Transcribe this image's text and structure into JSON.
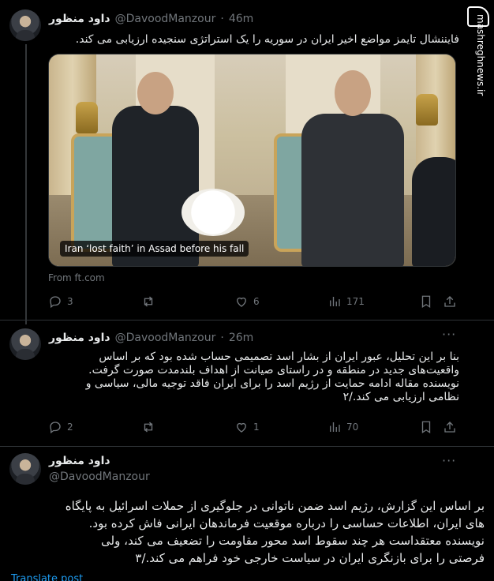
{
  "tweets": [
    {
      "name": "داود منظور",
      "handle": "@DavoodManzour",
      "time": "46m",
      "separator": "·",
      "text": "فایننشال تایمز مواضع اخیر ایران در سوریه را یک استراتژی سنجیده ارزیابی می کند.",
      "media_caption": "Iran ‘lost faith’ in Assad before his fall",
      "from": "From ft.com",
      "replies": "3",
      "likes": "6",
      "views": "171"
    },
    {
      "name": "داود منظور",
      "handle": "@DavoodManzour",
      "time": "26m",
      "separator": "·",
      "text_lines": [
        "بنا بر این تحلیل، عبور ایران از بشار اسد تصمیمی حساب شده بود که بر اساس",
        "واقعیت‌های جدید در منطقه و در راستای صیانت از اهداف بلندمدت صورت گرفت.",
        "نویسنده مقاله ادامه حمایت از رژیم اسد را برای ایران فاقد توجیه مالی، سیاسی و",
        "نظامی ارزیابی می کند./۲"
      ],
      "replies": "2",
      "likes": "1",
      "views": "70"
    },
    {
      "name": "داود منظور",
      "handle": "@DavoodManzour",
      "text_lines": [
        "بر اساس این گزارش، رژیم اسد ضمن ناتوانی در جلوگیری از حملات اسرائیل به پایگاه",
        "های ایران، اطلاعات حساسی را درباره موقعیت فرماندهان ایرانی فاش کرده بود.",
        "نویسنده معتقداست هر چند سقوط اسد محور مقاومت را تضعیف می کند، ولی",
        "فرصتی را برای بازنگری ایران در سیاست خارجی خود فراهم می کند./۳"
      ],
      "translate": "Translate post"
    }
  ],
  "watermark": {
    "site": "mashreghnews.ir"
  },
  "icons": [
    "reply-icon",
    "retweet-icon",
    "like-icon",
    "views-icon",
    "bookmark-icon",
    "share-icon",
    "more-icon"
  ]
}
